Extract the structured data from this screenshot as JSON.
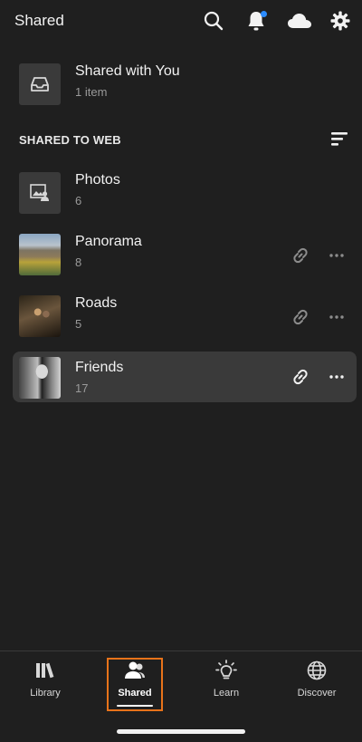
{
  "header": {
    "title": "Shared",
    "icons": [
      "search-icon",
      "bell-icon",
      "cloud-icon",
      "gear-icon"
    ],
    "notification_dot_color": "#2b8cff"
  },
  "shared_with_you": {
    "title": "Shared with You",
    "subtitle": "1 item",
    "icon": "inbox-icon"
  },
  "section": {
    "heading": "SHARED TO WEB",
    "sort_icon": "sort-icon"
  },
  "albums": [
    {
      "title": "Photos",
      "count": "6"
    },
    {
      "title": "Panorama",
      "count": "8"
    },
    {
      "title": "Roads",
      "count": "5"
    },
    {
      "title": "Friends",
      "count": "17"
    }
  ],
  "bottom_nav": {
    "items": [
      {
        "label": "Library",
        "icon": "library-icon"
      },
      {
        "label": "Shared",
        "icon": "people-icon"
      },
      {
        "label": "Learn",
        "icon": "lightbulb-icon"
      },
      {
        "label": "Discover",
        "icon": "globe-icon"
      }
    ],
    "active_index": 1,
    "highlight_color": "#e8731a"
  }
}
